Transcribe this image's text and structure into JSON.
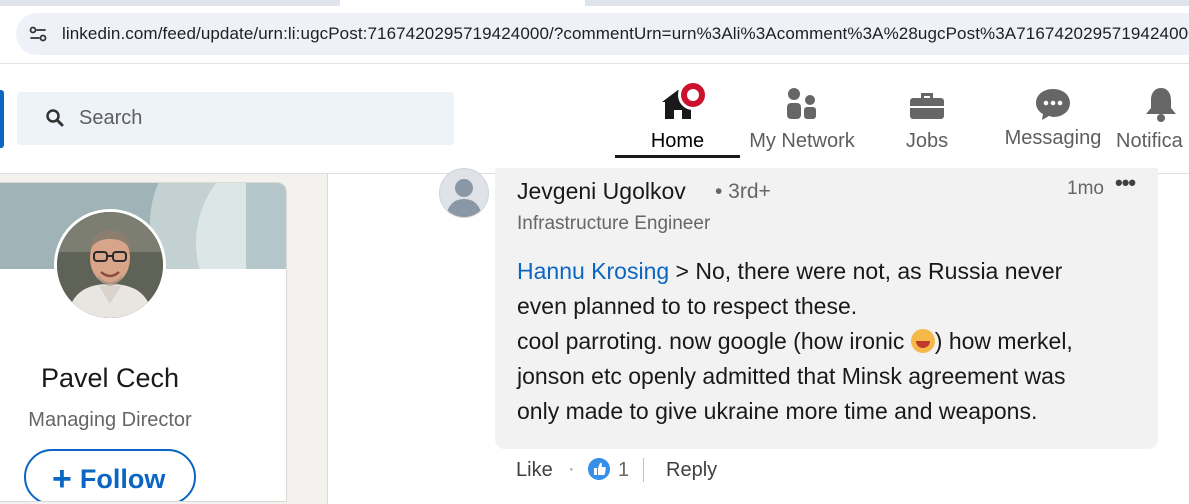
{
  "browser": {
    "url": "linkedin.com/feed/update/urn:li:ugcPost:7167420295719424000/?commentUrn=urn%3Ali%3Acomment%3A%28ugcPost%3A7167420295719424000"
  },
  "nav": {
    "search_placeholder": "Search",
    "items": [
      {
        "label": "Home",
        "icon": "home-icon"
      },
      {
        "label": "My Network",
        "icon": "network-icon"
      },
      {
        "label": "Jobs",
        "icon": "briefcase-icon"
      },
      {
        "label": "Messaging",
        "icon": "messaging-icon"
      },
      {
        "label": "Notifica",
        "icon": "bell-icon"
      }
    ]
  },
  "profile": {
    "name": "Pavel Cech",
    "title": "Managing Director",
    "follow_label": "Follow"
  },
  "comment": {
    "author": "Jevgeni Ugolkov",
    "degree": "• 3rd+",
    "headline": "Infrastructure Engineer",
    "time": "1mo",
    "more": "•••",
    "mention": "Hannu Krosing",
    "line1_rest": " > No, there were not, as Russia never",
    "line2": "even planned to to respect these.",
    "line3a": "cool parroting. now google (how ironic ",
    "line3b": ") how merkel,",
    "line4": "jonson etc openly admitted that Minsk agreement was",
    "line5": "only made to give ukraine more time and weapons.",
    "like_label": "Like",
    "like_count": "1",
    "reply_label": "Reply"
  },
  "colors": {
    "brand": "#0a66c2",
    "notification": "#cb112d"
  }
}
